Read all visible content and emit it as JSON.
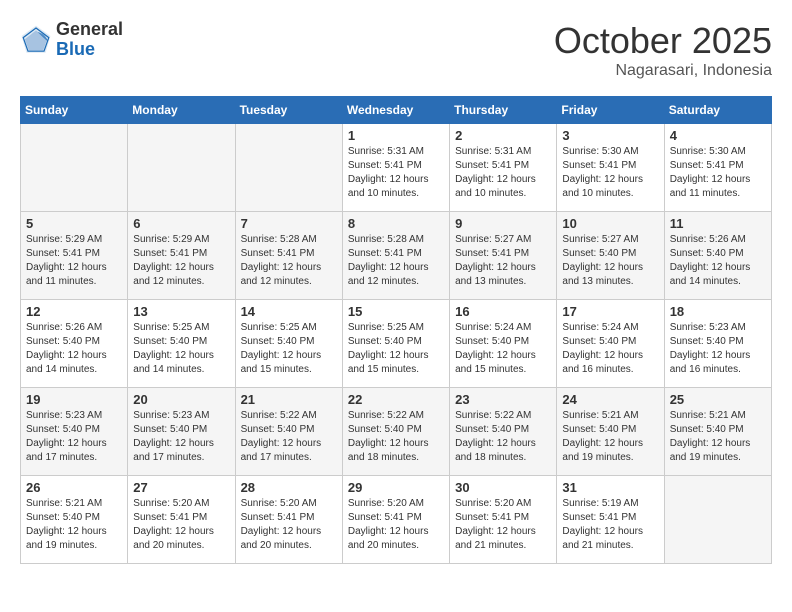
{
  "header": {
    "logo_general": "General",
    "logo_blue": "Blue",
    "month_title": "October 2025",
    "location": "Nagarasari, Indonesia"
  },
  "days_of_week": [
    "Sunday",
    "Monday",
    "Tuesday",
    "Wednesday",
    "Thursday",
    "Friday",
    "Saturday"
  ],
  "weeks": [
    [
      {
        "day": "",
        "info": ""
      },
      {
        "day": "",
        "info": ""
      },
      {
        "day": "",
        "info": ""
      },
      {
        "day": "1",
        "info": "Sunrise: 5:31 AM\nSunset: 5:41 PM\nDaylight: 12 hours\nand 10 minutes."
      },
      {
        "day": "2",
        "info": "Sunrise: 5:31 AM\nSunset: 5:41 PM\nDaylight: 12 hours\nand 10 minutes."
      },
      {
        "day": "3",
        "info": "Sunrise: 5:30 AM\nSunset: 5:41 PM\nDaylight: 12 hours\nand 10 minutes."
      },
      {
        "day": "4",
        "info": "Sunrise: 5:30 AM\nSunset: 5:41 PM\nDaylight: 12 hours\nand 11 minutes."
      }
    ],
    [
      {
        "day": "5",
        "info": "Sunrise: 5:29 AM\nSunset: 5:41 PM\nDaylight: 12 hours\nand 11 minutes."
      },
      {
        "day": "6",
        "info": "Sunrise: 5:29 AM\nSunset: 5:41 PM\nDaylight: 12 hours\nand 12 minutes."
      },
      {
        "day": "7",
        "info": "Sunrise: 5:28 AM\nSunset: 5:41 PM\nDaylight: 12 hours\nand 12 minutes."
      },
      {
        "day": "8",
        "info": "Sunrise: 5:28 AM\nSunset: 5:41 PM\nDaylight: 12 hours\nand 12 minutes."
      },
      {
        "day": "9",
        "info": "Sunrise: 5:27 AM\nSunset: 5:41 PM\nDaylight: 12 hours\nand 13 minutes."
      },
      {
        "day": "10",
        "info": "Sunrise: 5:27 AM\nSunset: 5:40 PM\nDaylight: 12 hours\nand 13 minutes."
      },
      {
        "day": "11",
        "info": "Sunrise: 5:26 AM\nSunset: 5:40 PM\nDaylight: 12 hours\nand 14 minutes."
      }
    ],
    [
      {
        "day": "12",
        "info": "Sunrise: 5:26 AM\nSunset: 5:40 PM\nDaylight: 12 hours\nand 14 minutes."
      },
      {
        "day": "13",
        "info": "Sunrise: 5:25 AM\nSunset: 5:40 PM\nDaylight: 12 hours\nand 14 minutes."
      },
      {
        "day": "14",
        "info": "Sunrise: 5:25 AM\nSunset: 5:40 PM\nDaylight: 12 hours\nand 15 minutes."
      },
      {
        "day": "15",
        "info": "Sunrise: 5:25 AM\nSunset: 5:40 PM\nDaylight: 12 hours\nand 15 minutes."
      },
      {
        "day": "16",
        "info": "Sunrise: 5:24 AM\nSunset: 5:40 PM\nDaylight: 12 hours\nand 15 minutes."
      },
      {
        "day": "17",
        "info": "Sunrise: 5:24 AM\nSunset: 5:40 PM\nDaylight: 12 hours\nand 16 minutes."
      },
      {
        "day": "18",
        "info": "Sunrise: 5:23 AM\nSunset: 5:40 PM\nDaylight: 12 hours\nand 16 minutes."
      }
    ],
    [
      {
        "day": "19",
        "info": "Sunrise: 5:23 AM\nSunset: 5:40 PM\nDaylight: 12 hours\nand 17 minutes."
      },
      {
        "day": "20",
        "info": "Sunrise: 5:23 AM\nSunset: 5:40 PM\nDaylight: 12 hours\nand 17 minutes."
      },
      {
        "day": "21",
        "info": "Sunrise: 5:22 AM\nSunset: 5:40 PM\nDaylight: 12 hours\nand 17 minutes."
      },
      {
        "day": "22",
        "info": "Sunrise: 5:22 AM\nSunset: 5:40 PM\nDaylight: 12 hours\nand 18 minutes."
      },
      {
        "day": "23",
        "info": "Sunrise: 5:22 AM\nSunset: 5:40 PM\nDaylight: 12 hours\nand 18 minutes."
      },
      {
        "day": "24",
        "info": "Sunrise: 5:21 AM\nSunset: 5:40 PM\nDaylight: 12 hours\nand 19 minutes."
      },
      {
        "day": "25",
        "info": "Sunrise: 5:21 AM\nSunset: 5:40 PM\nDaylight: 12 hours\nand 19 minutes."
      }
    ],
    [
      {
        "day": "26",
        "info": "Sunrise: 5:21 AM\nSunset: 5:40 PM\nDaylight: 12 hours\nand 19 minutes."
      },
      {
        "day": "27",
        "info": "Sunrise: 5:20 AM\nSunset: 5:41 PM\nDaylight: 12 hours\nand 20 minutes."
      },
      {
        "day": "28",
        "info": "Sunrise: 5:20 AM\nSunset: 5:41 PM\nDaylight: 12 hours\nand 20 minutes."
      },
      {
        "day": "29",
        "info": "Sunrise: 5:20 AM\nSunset: 5:41 PM\nDaylight: 12 hours\nand 20 minutes."
      },
      {
        "day": "30",
        "info": "Sunrise: 5:20 AM\nSunset: 5:41 PM\nDaylight: 12 hours\nand 21 minutes."
      },
      {
        "day": "31",
        "info": "Sunrise: 5:19 AM\nSunset: 5:41 PM\nDaylight: 12 hours\nand 21 minutes."
      },
      {
        "day": "",
        "info": ""
      }
    ]
  ]
}
